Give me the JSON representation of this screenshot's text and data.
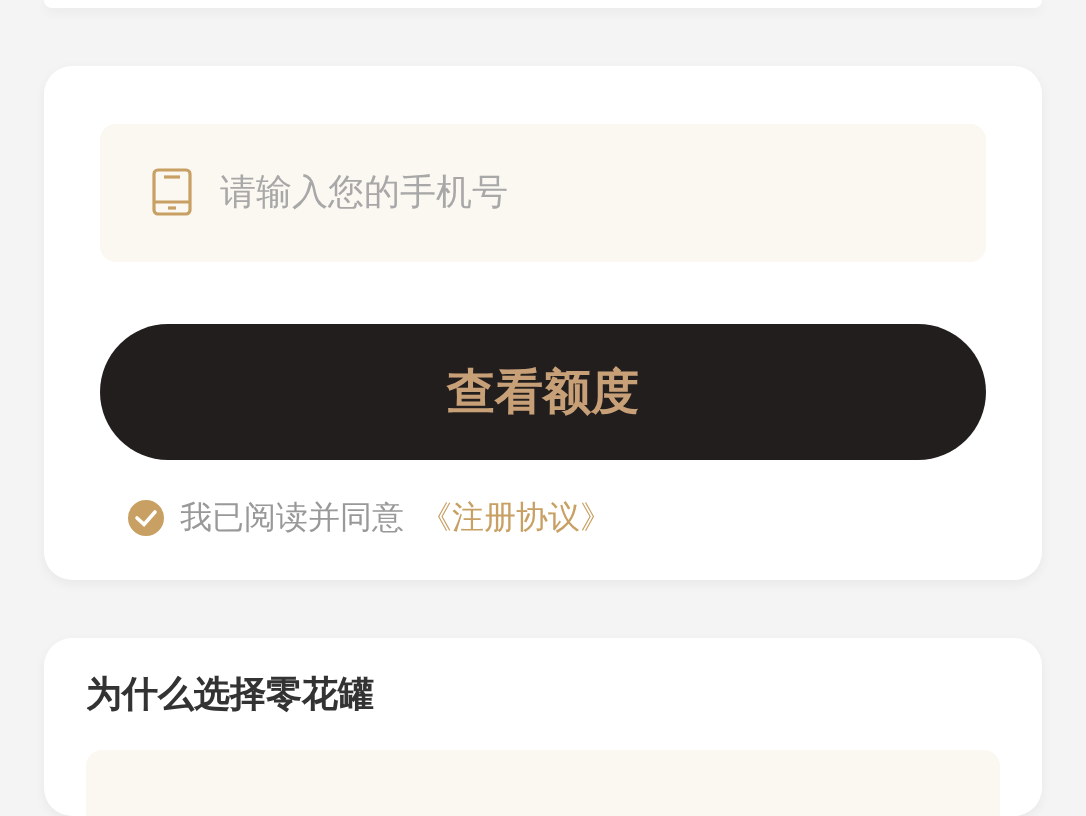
{
  "form": {
    "phone_field": {
      "placeholder": "请输入您的手机号"
    },
    "submit_button": {
      "label": "查看额度"
    },
    "agreement": {
      "checked": true,
      "text": "我已阅读并同意",
      "link": "《注册协议》"
    }
  },
  "why_section": {
    "title": "为什么选择零花罐"
  }
}
